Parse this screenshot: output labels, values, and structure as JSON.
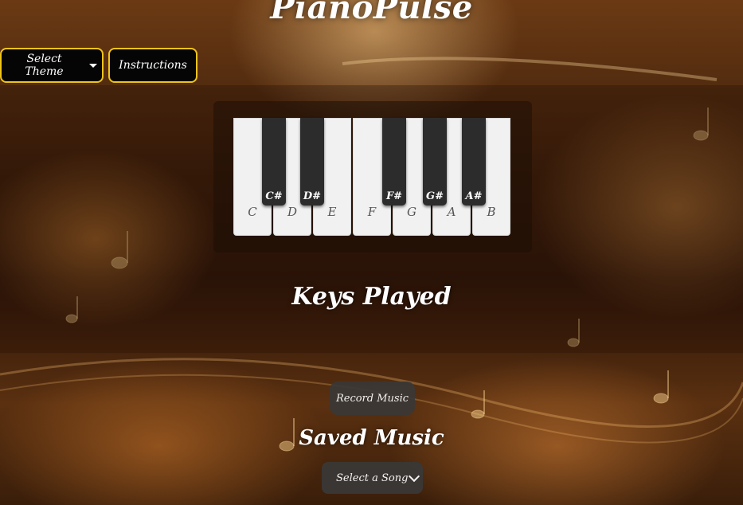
{
  "app": {
    "title": "PianoPulse"
  },
  "nav": {
    "theme_label": "Select Theme",
    "instructions_label": "Instructions"
  },
  "piano": {
    "white_keys": [
      "C",
      "D",
      "E",
      "F",
      "G",
      "A",
      "B"
    ],
    "black_keys": [
      "C#",
      "D#",
      "F#",
      "G#",
      "A#"
    ]
  },
  "keys_played": {
    "title": "Keys Played"
  },
  "record": {
    "label": "Record Music"
  },
  "saved": {
    "title": "Saved Music",
    "select_value": "Select a Song"
  },
  "colors": {
    "accent_border": "#f0c419",
    "white_key": "#f1f1f1",
    "black_key": "#2c2c2c",
    "button_dark": "#3a3836"
  }
}
